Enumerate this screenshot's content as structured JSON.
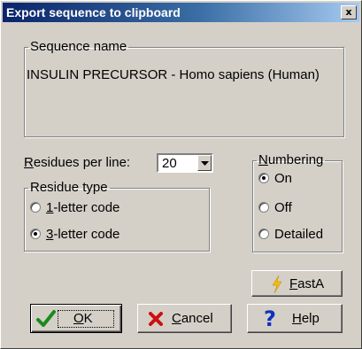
{
  "window": {
    "title": "Export sequence to clipboard",
    "close_glyph": "x"
  },
  "sequence": {
    "group_label": "Sequence name",
    "value": "INSULIN PRECURSOR - Homo sapiens (Human)"
  },
  "residues_per_line": {
    "label_accel": "R",
    "label_rest": "esidues per line:",
    "value": "20"
  },
  "residue_type": {
    "group_label": "Residue type",
    "options": [
      {
        "accel": "1",
        "rest": "-letter code",
        "selected": false
      },
      {
        "accel": "3",
        "rest": "-letter code",
        "selected": true
      }
    ]
  },
  "numbering": {
    "group_label_accel": "N",
    "group_label_rest": "umbering",
    "options": [
      {
        "label": "On",
        "selected": true
      },
      {
        "label": "Off",
        "selected": false
      },
      {
        "label": "Detailed",
        "selected": false
      }
    ]
  },
  "buttons": {
    "fasta": {
      "accel": "F",
      "rest": "astA",
      "icon": "lightning-icon"
    },
    "ok": {
      "accel": "O",
      "rest": "K",
      "icon": "checkmark-icon"
    },
    "cancel": {
      "accel": "C",
      "rest": "ancel",
      "icon": "x-icon"
    },
    "help": {
      "accel": "H",
      "rest": "elp",
      "icon": "question-icon"
    }
  },
  "colors": {
    "title_bar_start": "#0a246a",
    "title_bar_end": "#a6caf0",
    "dialog_face": "#d4d0c8",
    "ok_icon": "#1a8a1a",
    "cancel_icon": "#cc1010",
    "help_icon": "#1030c0",
    "fasta_icon": "#f0c000"
  }
}
